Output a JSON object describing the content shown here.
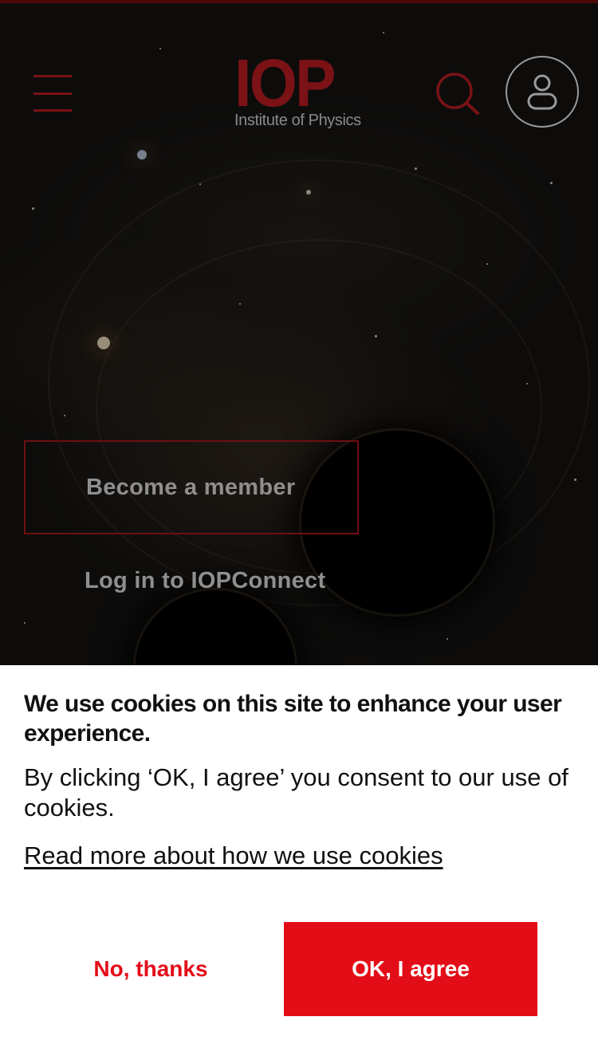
{
  "header": {
    "logo": {
      "main": "IOP",
      "sub": "Institute of Physics"
    },
    "menu_icon": "hamburger-icon",
    "search_icon": "search-icon",
    "account_icon": "user-icon"
  },
  "hero": {
    "become_member_label": "Become a member",
    "login_label": "Log in to IOPConnect"
  },
  "cookie_banner": {
    "title": "We use cookies on this site to enhance your user experience.",
    "body": "By clicking ‘OK, I agree’ you consent to our use of cookies.",
    "read_more_link": "Read more about how we use cookies",
    "decline_label": "No, thanks",
    "accept_label": "OK, I agree"
  },
  "colors": {
    "brand_red": "#e30d18",
    "dim_red": "#7a1216",
    "banner_bg": "#ffffff",
    "hero_text": "#8f8f8f"
  }
}
